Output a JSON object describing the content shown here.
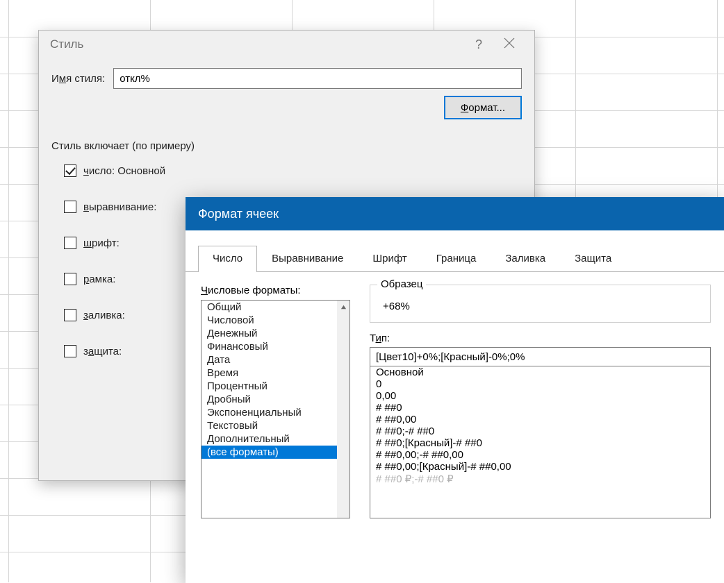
{
  "style_dialog": {
    "title": "Стиль",
    "name_label_pre": "И",
    "name_label_u": "м",
    "name_label_post": "я стиля:",
    "name_value": "откл%",
    "format_btn_u": "Ф",
    "format_btn_rest": "ормат...",
    "section_label": "Стиль включает (по примеру)",
    "checks": [
      {
        "checked": true,
        "u": "ч",
        "rest": "исло: Основной"
      },
      {
        "checked": false,
        "u": "в",
        "rest": "ыравнивание:"
      },
      {
        "checked": false,
        "u": "ш",
        "rest": "рифт:"
      },
      {
        "checked": false,
        "u": "р",
        "rest": "амка:"
      },
      {
        "checked": false,
        "u": "з",
        "rest": "аливка:"
      },
      {
        "checked": false,
        "pre": "з",
        "u": "а",
        "rest": "щита:"
      }
    ]
  },
  "format_cells": {
    "title": "Формат ячеек",
    "tabs": [
      "Число",
      "Выравнивание",
      "Шрифт",
      "Граница",
      "Заливка",
      "Защита"
    ],
    "active_tab": 0,
    "categories_label_u": "Ч",
    "categories_label_rest": "исловые форматы:",
    "categories": [
      "Общий",
      "Числовой",
      "Денежный",
      "Финансовый",
      "Дата",
      "Время",
      "Процентный",
      "Дробный",
      "Экспоненциальный",
      "Текстовый",
      "Дополнительный",
      "(все форматы)"
    ],
    "selected_category": 11,
    "sample_legend": "Образец",
    "sample_value": "+68%",
    "type_label_pre": "Т",
    "type_label_u": "и",
    "type_label_post": "п:",
    "type_value": "[Цвет10]+0%;[Красный]-0%;0%",
    "format_items": [
      "Основной",
      "0",
      "0,00",
      "# ##0",
      "# ##0,00",
      "# ##0;-# ##0",
      "# ##0;[Красный]-# ##0",
      "# ##0,00;-# ##0,00",
      "# ##0,00;[Красный]-# ##0,00",
      "# ##0 ₽;-# ##0 ₽"
    ]
  }
}
